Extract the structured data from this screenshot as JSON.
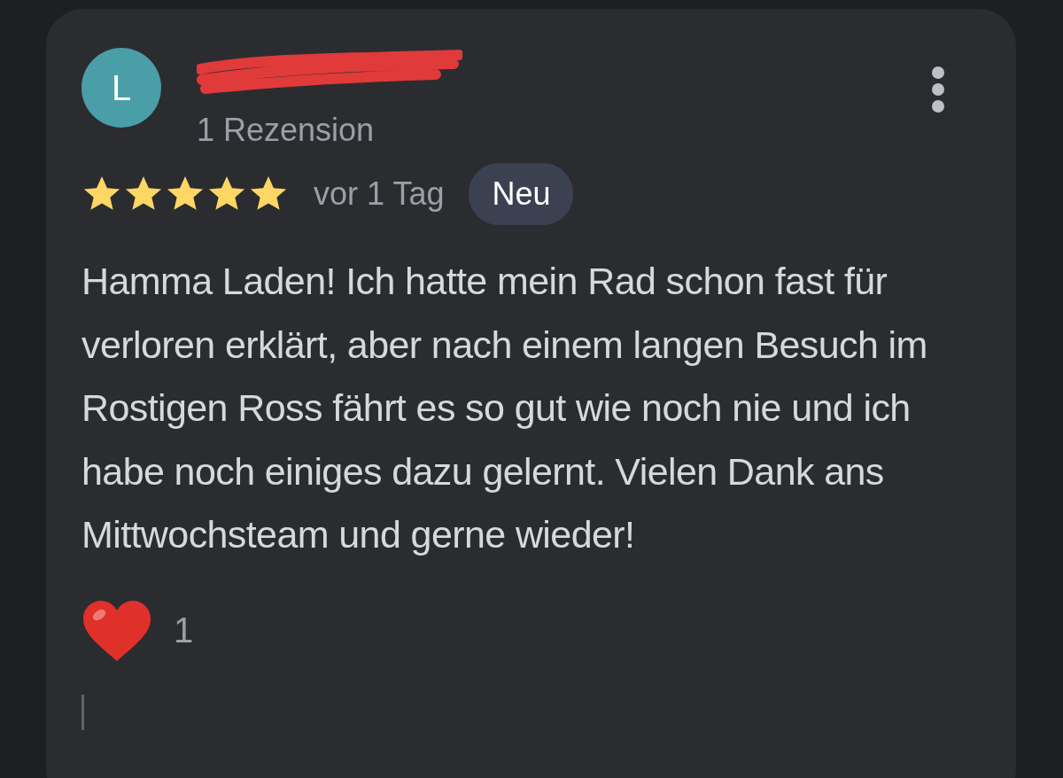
{
  "review": {
    "avatar_letter": "L",
    "review_count": "1 Rezension",
    "stars": 5,
    "date": "vor 1 Tag",
    "badge": "Neu",
    "text": "Hamma Laden! Ich hatte mein Rad schon fast für verloren erklärt, aber nach einem langen Besuch im Rostigen Ross fährt es so gut wie noch nie und ich habe noch einiges dazu gelernt. Vielen Dank ans Mittwochsteam und gerne wieder!",
    "reaction_count": "1"
  }
}
